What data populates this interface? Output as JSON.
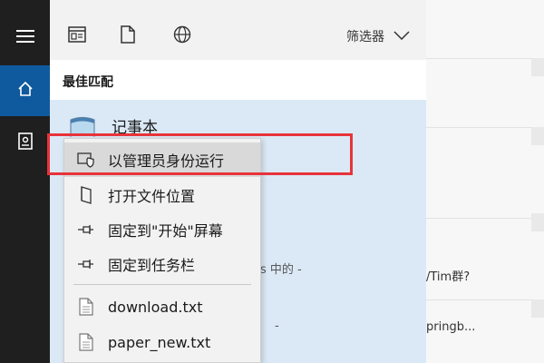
{
  "background": {
    "rows": [
      {
        "text": "/Tim群?"
      },
      {
        "text": "pringb..."
      }
    ]
  },
  "rail": {
    "items": [
      {
        "icon": "hamburger-menu-icon"
      },
      {
        "icon": "home-icon",
        "active": true
      },
      {
        "icon": "document-icon"
      }
    ]
  },
  "toolbar": {
    "icons": [
      "apps-icon",
      "document-icon",
      "web-icon"
    ],
    "filter_label": "筛选器"
  },
  "section_title": "最佳匹配",
  "best_match": {
    "app_name": "记事本",
    "icon": "notepad-icon"
  },
  "behind_text": {
    "fragment1": "s 中的 -",
    "fragment2": "-"
  },
  "context_menu": {
    "items": [
      {
        "label": "以管理员身份运行",
        "icon": "admin-shield-icon"
      },
      {
        "label": "打开文件位置",
        "icon": "open-folder-icon"
      },
      {
        "label": "固定到\"开始\"屏幕",
        "icon": "pin-icon"
      },
      {
        "label": "固定到任务栏",
        "icon": "pin-icon"
      }
    ],
    "recent": [
      {
        "label": "download.txt",
        "icon": "text-file-icon"
      },
      {
        "label": "paper_new.txt",
        "icon": "text-file-icon"
      }
    ]
  },
  "colors": {
    "highlight": "#e8333a",
    "accent": "#0f5a9e",
    "best_match_bg": "#dbe9f6"
  }
}
